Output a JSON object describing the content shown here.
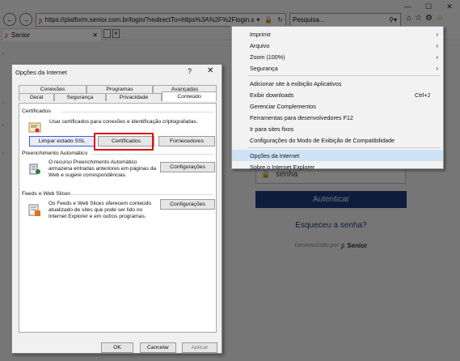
{
  "browser": {
    "minimize": "—",
    "maximize": "☐",
    "close": "✕",
    "back_icon": "←",
    "forward_icon": "→",
    "url": "https://platform.senior.com.br/login/?redirectTo=https%3A%2F%2Flogin.seni",
    "search_placeholder": "Pesquisa...",
    "tab_title": "Senior",
    "tab_close": "✕"
  },
  "menu": {
    "items": [
      {
        "label": "Imprimir",
        "arrow": "›",
        "shortcut": ""
      },
      {
        "label": "Arquivo",
        "arrow": "›",
        "shortcut": ""
      },
      {
        "label": "Zoom (100%)",
        "arrow": "›",
        "shortcut": ""
      },
      {
        "label": "Segurança",
        "arrow": "›",
        "shortcut": ""
      },
      {
        "label": "Adicionar site à exibição Aplicativos",
        "arrow": "",
        "shortcut": ""
      },
      {
        "label": "Exibir downloads",
        "arrow": "",
        "shortcut": "Ctrl+J"
      },
      {
        "label": "Gerenciar Complementos",
        "arrow": "",
        "shortcut": ""
      },
      {
        "label": "Ferramentas para desenvolvedores F12",
        "arrow": "",
        "shortcut": ""
      },
      {
        "label": "Ir para sites fixos",
        "arrow": "",
        "shortcut": ""
      },
      {
        "label": "Configurações do Modo de Exibição de Compatibilidade",
        "arrow": "",
        "shortcut": ""
      },
      {
        "label": "Opções da Internet",
        "arrow": "",
        "shortcut": ""
      },
      {
        "label": "Sobre o Internet Explorer",
        "arrow": "",
        "shortcut": ""
      }
    ]
  },
  "login": {
    "password_placeholder": "senha",
    "authenticate": "Autenticar",
    "forgot": "Esqueceu a senha?",
    "powered_by": "Desenvolvido por",
    "brand": "Senior"
  },
  "dialog": {
    "title": "Opções da Internet",
    "help": "?",
    "close": "✕",
    "tabs_row1": [
      "Conexões",
      "Programas",
      "Avançadas"
    ],
    "tabs_row2": [
      "Geral",
      "Segurança",
      "Privacidade",
      "Conteúdo"
    ],
    "certificates": {
      "heading": "Certificados",
      "text": "Usar certificados para conexões e identificação criptografadas.",
      "btn_clear_ssl": "Limpar estado SSL",
      "btn_certificates": "Certificados",
      "btn_publishers": "Fornecedores"
    },
    "autocomplete": {
      "heading": "Preenchimento Automático",
      "text": "O recurso Preenchimento Automático armazena entradas anteriores em páginas da Web e sugere correspondências.",
      "btn_settings": "Configurações"
    },
    "feeds": {
      "heading": "Feeds e Web Slices",
      "text": "Os Feeds e Web Slices oferecem conteúdo atualizado de sites que pode ser lido no Internet Explorer e em outros programas.",
      "btn_settings": "Configurações"
    },
    "ok": "OK",
    "cancel": "Cancelar",
    "apply": "Aplicar"
  }
}
